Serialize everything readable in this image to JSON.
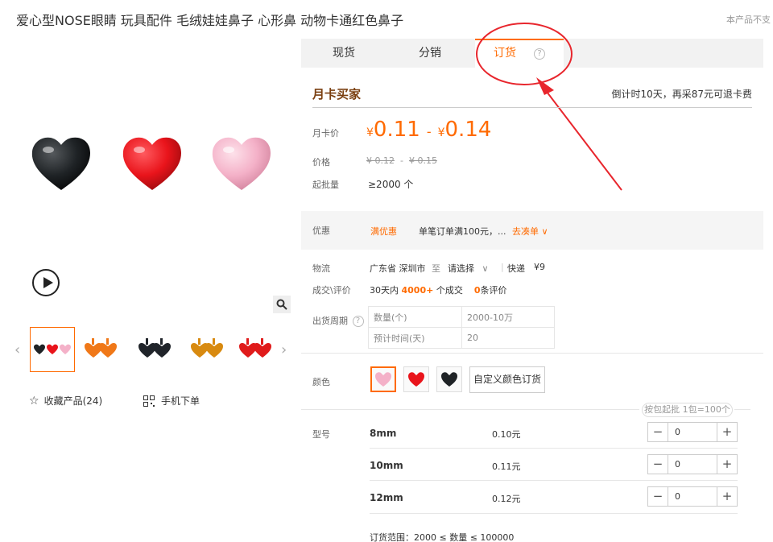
{
  "product": {
    "title": "爱心型NOSE眼睛 玩具配件 毛绒娃娃鼻子 心形鼻 动物卡通红色鼻子",
    "note": "本产品不支"
  },
  "gallery": {
    "hearts": [
      {
        "color": "#1f2326",
        "icon": "black-heart-icon"
      },
      {
        "color": "#e9141b",
        "icon": "red-heart-icon"
      },
      {
        "color": "#f4b1c8",
        "icon": "pink-heart-icon"
      }
    ],
    "thumb_colors": [
      "#2a2a2a",
      "#f07818",
      "#20242a",
      "#d88a10",
      "#e01b1b"
    ],
    "favorite_label": "收藏产品(24)",
    "mobile_label": "手机下单"
  },
  "tabs": [
    {
      "label": "现货"
    },
    {
      "label": "分销"
    },
    {
      "label": "订货",
      "help": "?"
    }
  ],
  "card": {
    "title": "月卡买家",
    "countdown": "倒计时10天，再采87元可退卡费"
  },
  "price": {
    "label": "月卡价",
    "currency": "¥",
    "low": "0.11",
    "high": "0.14",
    "dash": "-",
    "orig_label": "价格",
    "orig_low": "¥ 0.12",
    "orig_high": "¥ 0.15",
    "min_label": "起批量",
    "min_value": "≥2000 个"
  },
  "promo": {
    "label": "优惠",
    "tag": "满优惠",
    "text": "单笔订单满100元，...",
    "link": "去凑单 ∨"
  },
  "logistics": {
    "label": "物流",
    "from": "广东省 深圳市",
    "to": "至",
    "select": "请选择",
    "method": "快递",
    "fee": "¥9"
  },
  "deals": {
    "label": "成交\\评价",
    "prefix": "30天内",
    "count": "4000+",
    "suffix": "个成交",
    "reviews": "0",
    "reviews_suffix": "条评价"
  },
  "delivery": {
    "label": "出货周期",
    "rows": [
      [
        "数量(个)",
        "2000-10万"
      ],
      [
        "预计时间(天)",
        "20"
      ]
    ]
  },
  "colors": {
    "label": "颜色",
    "swatches": [
      {
        "name": "pink",
        "hex": "#f4b1c8"
      },
      {
        "name": "red",
        "hex": "#e9141b"
      },
      {
        "name": "black",
        "hex": "#1f2326"
      }
    ],
    "custom_button": "自定义颜色订货"
  },
  "pack_note": "按包起批 1包=100个",
  "sizes": {
    "label": "型号",
    "items": [
      {
        "name": "8mm",
        "price": "0.10元",
        "qty": "0"
      },
      {
        "name": "10mm",
        "price": "0.11元",
        "qty": "0"
      },
      {
        "name": "12mm",
        "price": "0.12元",
        "qty": "0"
      }
    ],
    "minus": "−",
    "plus": "+"
  },
  "order_range": "订货范围：2000 ≤ 数量 ≤ 100000",
  "annotation_color": "#e8262d"
}
